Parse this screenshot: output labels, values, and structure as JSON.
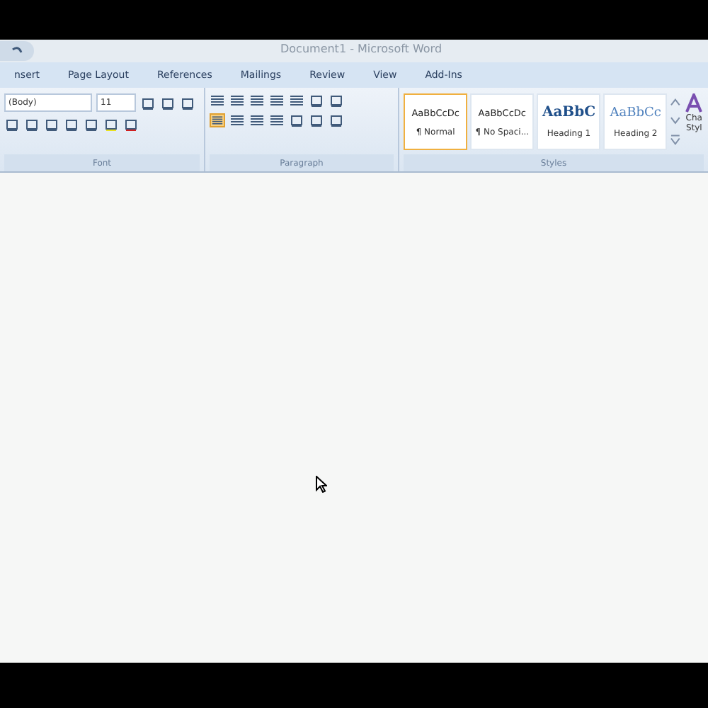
{
  "window": {
    "title": "Document1 - Microsoft Word"
  },
  "tabs": [
    {
      "label": "nsert",
      "selected": false
    },
    {
      "label": "Page Layout",
      "selected": false
    },
    {
      "label": "References",
      "selected": false
    },
    {
      "label": "Mailings",
      "selected": false
    },
    {
      "label": "Review",
      "selected": false
    },
    {
      "label": "View",
      "selected": false
    },
    {
      "label": "Add-Ins",
      "selected": false
    }
  ],
  "font_group": {
    "font_name": "(Body)",
    "font_size": "11",
    "label": "Font"
  },
  "paragraph_group": {
    "label": "Paragraph",
    "align_left_selected": true
  },
  "styles_group": {
    "label": "Styles",
    "items": [
      {
        "preview": "AaBbCcDc",
        "name": "¶ Normal",
        "kind": "body",
        "selected": true
      },
      {
        "preview": "AaBbCcDc",
        "name": "¶ No Spaci...",
        "kind": "body",
        "selected": false
      },
      {
        "preview": "AaBbC",
        "name": "Heading 1",
        "kind": "heading1",
        "selected": false
      },
      {
        "preview": "AaBbCc",
        "name": "Heading 2",
        "kind": "heading2",
        "selected": false
      }
    ],
    "change_styles": {
      "line_1": "Cha",
      "line_2": "Styl"
    }
  }
}
